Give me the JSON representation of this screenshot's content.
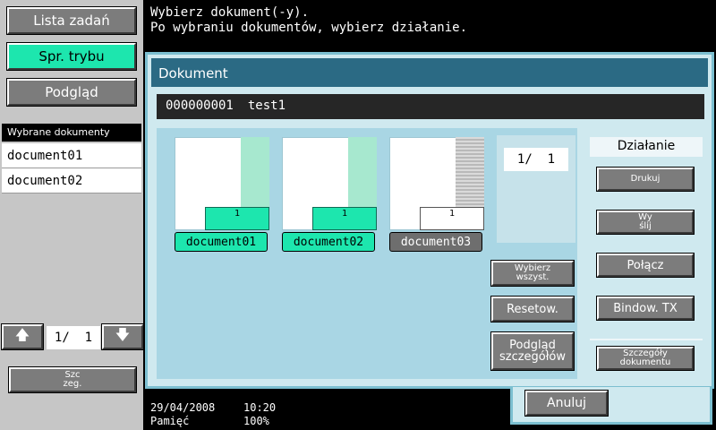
{
  "left": {
    "job_list": "Lista zadań",
    "check_mode": "Spr. trybu",
    "preview": "Podgląd",
    "selected_header": "Wybrane dokumenty",
    "selected_docs": [
      "document01",
      "document02"
    ],
    "pager": {
      "page": "1/",
      "total": "1"
    },
    "details_line1": "Szc",
    "details_line2": "zeg."
  },
  "message": {
    "line1": "Wybierz dokument(-y).",
    "line2": "Po wybraniu dokumentów, wybierz działanie."
  },
  "dialog": {
    "title": "Dokument",
    "doc_number": "000000001",
    "doc_name": "test1",
    "thumbnails": [
      {
        "name": "document01",
        "count": "1",
        "selected": true
      },
      {
        "name": "document02",
        "count": "1",
        "selected": true
      },
      {
        "name": "document03",
        "count": "1",
        "selected": false
      }
    ],
    "pager": {
      "page": "1/",
      "total": "1"
    },
    "select_all_l1": "Wybierz",
    "select_all_l2": "wszyst.",
    "reset": "Resetow.",
    "detail_preview_l1": "Podgląd",
    "detail_preview_l2": "szczegółów"
  },
  "action": {
    "header": "Działanie",
    "print": "Drukuj",
    "send_l1": "Wy",
    "send_l2": "ślij",
    "combine": "Połącz",
    "bind_tx": "Bindow. TX",
    "details_l1": "Szczegóły",
    "details_l2": "dokumentu"
  },
  "status": {
    "date": "29/04/2008",
    "time": "10:20",
    "memory_label": "Pamięć",
    "memory_value": "100%"
  },
  "cancel": "Anuluj",
  "colors": {
    "accent": "#1de6ae",
    "dialog_bg": "#cfe9ef",
    "title_bar": "#2b6a84"
  },
  "icons": {
    "up": "arrow-up-icon",
    "down": "arrow-down-icon"
  }
}
